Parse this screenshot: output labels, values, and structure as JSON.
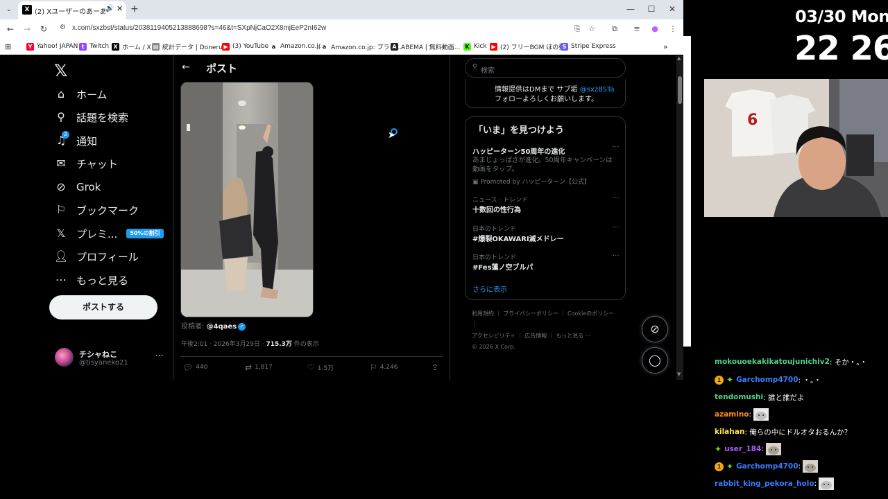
{
  "browser": {
    "tab_title": "(2) Xユーザーのあーあさん: 「警",
    "url": "x.com/sxzbst/status/2038119405213888698?s=46&t=SXpNjCaO2X8mjEeP2nI62w",
    "bookmarks": [
      "Yahoo! JAPAN",
      "Twitch",
      "ホーム / X",
      "統計データ | Doneru...",
      "(3) YouTube",
      "Amazon.co.jp",
      "Amazon.co.jp: プライ...",
      "ABEMA | 無料動画...",
      "Kick",
      "(2) フリーBGM ほの昼...",
      "Stripe Express"
    ]
  },
  "x": {
    "nav": [
      {
        "label": "ホーム",
        "icon": "home-icon"
      },
      {
        "label": "話題を検索",
        "icon": "search-icon"
      },
      {
        "label": "通知",
        "icon": "bell-icon",
        "badge": "2"
      },
      {
        "label": "チャット",
        "icon": "mail-icon"
      },
      {
        "label": "Grok",
        "icon": "grok-icon"
      },
      {
        "label": "ブックマーク",
        "icon": "bookmark-icon"
      },
      {
        "label": "プレミ...",
        "icon": "x-premium-icon"
      },
      {
        "label": "プロフィール",
        "icon": "person-icon"
      },
      {
        "label": "もっと見る",
        "icon": "more-circle-icon"
      }
    ],
    "premium_badge": "50%の割引",
    "post_button": "ポストする",
    "account": {
      "name": "チシャねこ",
      "handle": "@tisyaneko21"
    },
    "post_header": "ポスト",
    "poster_label": "投稿者:",
    "poster_handle": "@4qaes",
    "post_time": "午後2:01 · 2026年3月29日 · ",
    "views": "715.3万",
    "views_suffix": " 件の表示",
    "stats": {
      "replies": "440",
      "reposts": "1,817",
      "likes": "1.5万",
      "bookmarks": "4,246"
    },
    "search_placeholder": "検索",
    "profile_text_1": "情報提供はDMまで サブ垢 ",
    "profile_link": "@sxzBSTa",
    "profile_text_2": "フォローよろしくお願いします。",
    "trends_title": "「いま」を見つけよう",
    "trends": [
      {
        "title": "ハッピーターン50周年の進化",
        "desc": "あまじょっぱさが進化。50周年キャンペーンは動画をタップ。",
        "promo": "Promoted by ハッピーターン【公式】"
      },
      {
        "meta": "ニュース · トレンド",
        "title": "十数回の性行為"
      },
      {
        "meta": "日本のトレンド",
        "title": "#爆裂OKAWARI滅メドレー"
      },
      {
        "meta": "日本のトレンド",
        "title": "#Fes蓮ノ空ブルパ"
      }
    ],
    "show_more": "さらに表示",
    "footer": [
      "利用規約",
      "プライバシーポリシー",
      "Cookieのポリシー",
      "アクセシビリティ",
      "広告情報",
      "もっと見る ···",
      "© 2026 X Corp."
    ]
  },
  "overlay": {
    "date": "03/30 Mon",
    "time": "22 26",
    "chat": [
      {
        "user": "mokouoekakikatoujunichiv2",
        "color": "#4fd18b",
        "msg": ": そか・。・",
        "sub": false,
        "gem": false,
        "emote": false
      },
      {
        "user": "Garchomp4700",
        "color": "#3b7bff",
        "msg": ": ・。・",
        "sub": true,
        "sub_label": "1",
        "gem": true,
        "emote": false
      },
      {
        "user": "tendomushi",
        "color": "#4fd18b",
        "msg": ": 誰と誰だよ",
        "sub": false,
        "gem": false,
        "emote": false
      },
      {
        "user": "azamino",
        "color": "#ff8c1a",
        "msg": ":",
        "sub": false,
        "gem": false,
        "emote": true
      },
      {
        "user": "kilahan",
        "color": "#ffe34d",
        "msg": ": 俺らの中にドルオタおるんか？",
        "sub": false,
        "gem": false,
        "emote": false
      },
      {
        "user": "user_184",
        "color": "#b05cff",
        "msg": ":",
        "sub": false,
        "gem": true,
        "emote": true
      },
      {
        "user": "Garchomp4700",
        "color": "#3b7bff",
        "msg": ":",
        "sub": true,
        "sub_label": "1",
        "gem": true,
        "emote": true
      },
      {
        "user": "rabbit_king_pekora_holo",
        "color": "#3b7bff",
        "msg": ":",
        "sub": false,
        "gem": false,
        "emote": true
      }
    ]
  }
}
